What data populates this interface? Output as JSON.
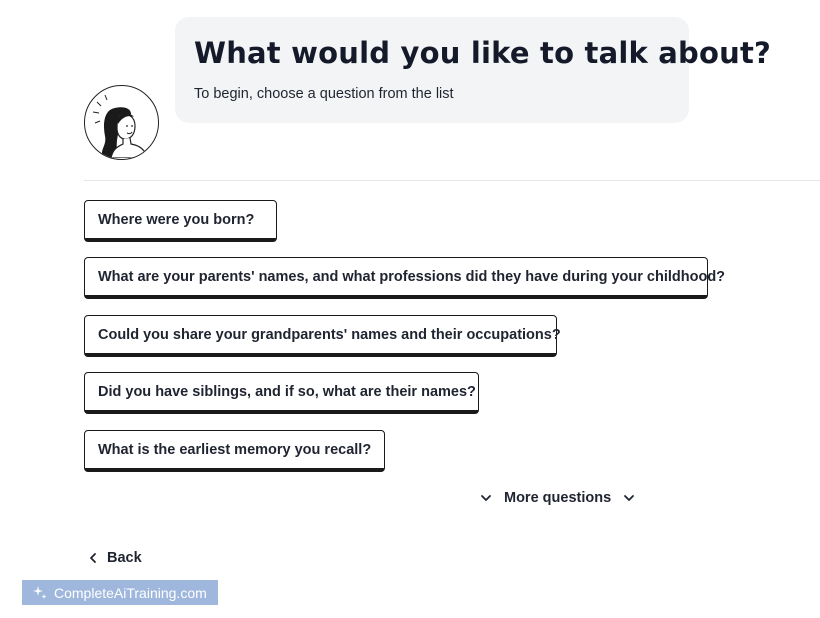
{
  "header": {
    "title": "What would you like to talk about?",
    "subtitle": "To begin, choose a question from the list"
  },
  "avatar": {
    "icon": "woman-portrait-icon"
  },
  "questions": [
    {
      "label": "Where were you born?"
    },
    {
      "label": "What are your parents' names, and what professions did they have during your childhood?"
    },
    {
      "label": "Could you share your grandparents' names and their occupations?"
    },
    {
      "label": "Did you have siblings, and if so, what are their names?"
    },
    {
      "label": "What is the earliest memory you recall?"
    }
  ],
  "more_questions": {
    "label": "More questions"
  },
  "back": {
    "label": "Back"
  },
  "watermark": {
    "text": "CompleteAiTraining.com"
  },
  "colors": {
    "bubble_bg": "#f3f4f6",
    "border": "#1a1a1a",
    "watermark_bg": "#9fb7dc"
  }
}
